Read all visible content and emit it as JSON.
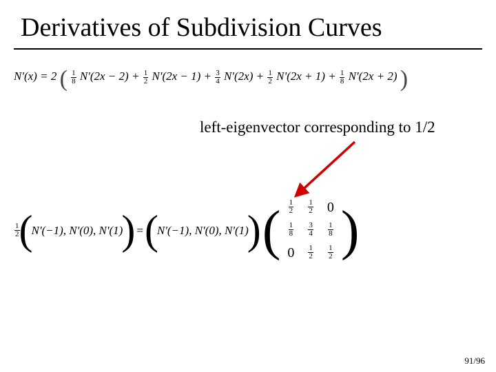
{
  "title": "Derivatives of Subdivision Curves",
  "caption": "left-eigenvector corresponding to 1/2",
  "page": "91/96",
  "eq1": {
    "lhs": "N'(x) = 2",
    "terms": [
      {
        "coef_n": "1",
        "coef_d": "8",
        "expr": "N'(2x − 2)"
      },
      {
        "coef_n": "1",
        "coef_d": "2",
        "expr": "N'(2x − 1)"
      },
      {
        "coef_n": "3",
        "coef_d": "4",
        "expr": "N'(2x)"
      },
      {
        "coef_n": "1",
        "coef_d": "2",
        "expr": "N'(2x + 1)"
      },
      {
        "coef_n": "1",
        "coef_d": "8",
        "expr": "N'(2x + 2)"
      }
    ]
  },
  "eq2": {
    "coef_n": "1",
    "coef_d": "2",
    "lhs_vec": "N'(−1), N'(0), N'(1)",
    "rhs_vec": "N'(−1), N'(0), N'(1)",
    "matrix": [
      [
        {
          "n": "1",
          "d": "2"
        },
        {
          "n": "1",
          "d": "2"
        },
        {
          "z": "0"
        }
      ],
      [
        {
          "n": "1",
          "d": "8"
        },
        {
          "n": "3",
          "d": "4"
        },
        {
          "n": "1",
          "d": "8"
        }
      ],
      [
        {
          "z": "0"
        },
        {
          "n": "1",
          "d": "2"
        },
        {
          "n": "1",
          "d": "2"
        }
      ]
    ]
  }
}
